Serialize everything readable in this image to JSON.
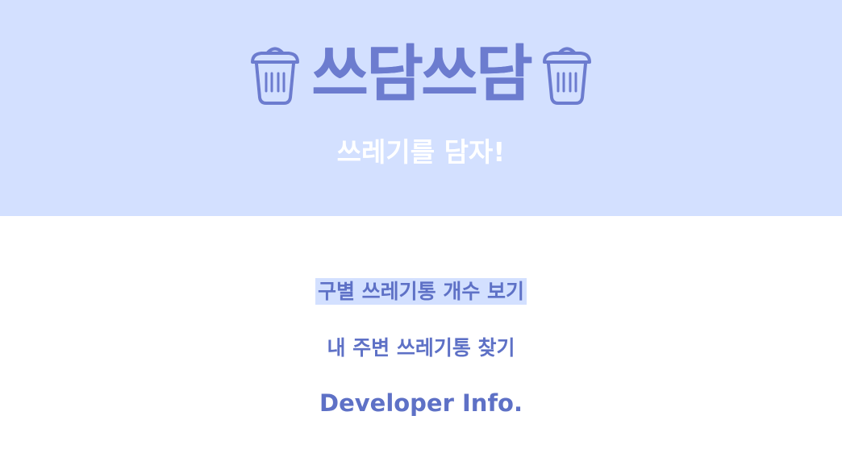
{
  "header": {
    "logo_text": "쓰담쓰담",
    "tagline": "쓰레기를 담자!",
    "left_icon": "trash-can-icon",
    "right_icon": "trash-can-icon",
    "background_color": "#d3e0ff",
    "accent_color": "#6c7ccf"
  },
  "menu": {
    "items": [
      {
        "label": "구별 쓰레기통 개수 보기",
        "selected": true
      },
      {
        "label": "내 주변 쓰레기통 찾기",
        "selected": false
      },
      {
        "label": "Developer Info.",
        "selected": false
      }
    ],
    "text_color": "#5e71c6"
  }
}
